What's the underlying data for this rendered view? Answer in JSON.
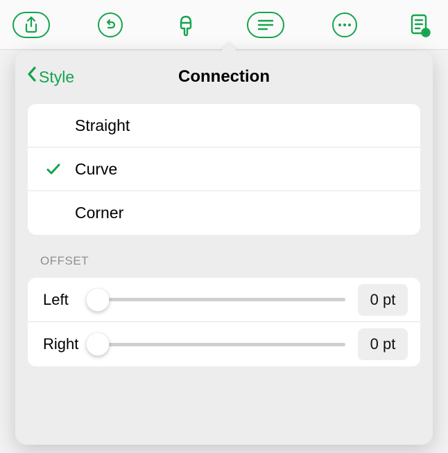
{
  "toolbar": {
    "icons": {
      "share": "share-icon",
      "undo": "undo-icon",
      "format": "format-brush-icon",
      "text": "text-lines-icon",
      "more": "more-icon",
      "presenter": "presenter-notes-icon"
    }
  },
  "popover": {
    "back_label": "Style",
    "title": "Connection",
    "options": [
      {
        "label": "Straight",
        "selected": false
      },
      {
        "label": "Curve",
        "selected": true
      },
      {
        "label": "Corner",
        "selected": false
      }
    ],
    "offset": {
      "section_title": "OFFSET",
      "rows": [
        {
          "label": "Left",
          "value_text": "0 pt",
          "position_pct": 3
        },
        {
          "label": "Right",
          "value_text": "0 pt",
          "position_pct": 3
        }
      ]
    }
  }
}
